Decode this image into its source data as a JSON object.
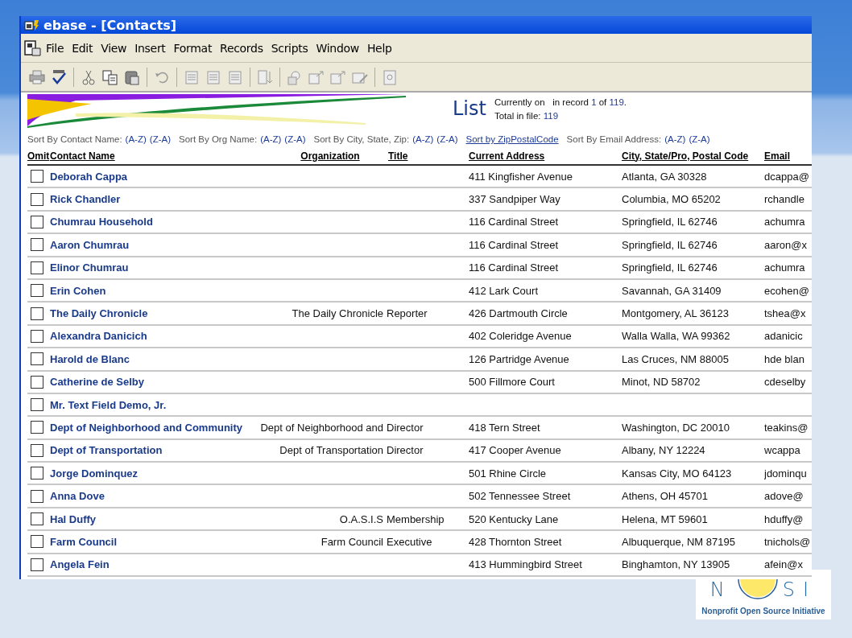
{
  "window": {
    "title": "ebase - [Contacts]"
  },
  "menu": [
    "File",
    "Edit",
    "View",
    "Insert",
    "Format",
    "Records",
    "Scripts",
    "Window",
    "Help"
  ],
  "header": {
    "title": "List",
    "record_line": [
      {
        "text": "Currently on   in record ",
        "highlight": false
      },
      {
        "text": "1",
        "highlight": true
      },
      {
        "text": " of ",
        "highlight": false
      },
      {
        "text": "119",
        "highlight": true
      },
      {
        "text": ".",
        "highlight": false
      }
    ],
    "total_line": [
      {
        "text": "Total in file: ",
        "highlight": false
      },
      {
        "text": "119",
        "highlight": true
      }
    ]
  },
  "sort_options": [
    {
      "kind": "pair",
      "label": "Sort By Contact Name:",
      "links": [
        "(A-Z)",
        "(Z-A)"
      ]
    },
    {
      "kind": "pair",
      "label": "Sort By Org Name:",
      "links": [
        "(A-Z)",
        "(Z-A)"
      ]
    },
    {
      "kind": "pair",
      "label": "Sort By City, State, Zip:",
      "links": [
        "(A-Z)",
        "(Z-A)"
      ]
    },
    {
      "kind": "link",
      "label": "Sort by ZipPostalCode"
    },
    {
      "kind": "pair",
      "label": "Sort By Email Address:",
      "links": [
        "(A-Z)",
        "(Z-A)"
      ]
    }
  ],
  "table": {
    "columns": [
      "Omit",
      "Contact Name",
      "Organization",
      "Title",
      "Current Address",
      "City, State/Pro, Postal Code",
      "Email"
    ],
    "rows": [
      {
        "omit": false,
        "name": "Deborah Cappa",
        "address": "411 Kingfisher Avenue",
        "city": "Atlanta, GA 30328",
        "email": "dcappa@"
      },
      {
        "omit": false,
        "name": "Rick Chandler",
        "address": "337 Sandpiper Way",
        "city": "Columbia, MO 65202",
        "email": "rchandle"
      },
      {
        "omit": false,
        "name": "Chumrau Household",
        "address": "116 Cardinal Street",
        "city": "Springfield, IL 62746",
        "email": "achumra"
      },
      {
        "omit": false,
        "name": "Aaron Chumrau",
        "address": "116 Cardinal Street",
        "city": "Springfield, IL 62746",
        "email": "aaron@x"
      },
      {
        "omit": false,
        "name": "Elinor Chumrau",
        "address": "116 Cardinal Street",
        "city": "Springfield, IL 62746",
        "email": "achumra"
      },
      {
        "omit": false,
        "name": "Erin Cohen",
        "address": "412 Lark Court",
        "city": "Savannah, GA 31409",
        "email": "ecohen@"
      },
      {
        "omit": false,
        "name": "The Daily Chronicle",
        "organization": "The Daily Chronicle",
        "title": "Reporter",
        "address": "426 Dartmouth Circle",
        "city": "Montgomery, AL 36123",
        "email": "tshea@x"
      },
      {
        "omit": false,
        "name": "Alexandra Danicich",
        "address": "402 Coleridge Avenue",
        "city": "Walla Walla, WA 99362",
        "email": "adanicic"
      },
      {
        "omit": false,
        "name": "Harold de Blanc",
        "address": "126 Partridge Avenue",
        "city": "Las Cruces, NM 88005",
        "email": "hde blan"
      },
      {
        "omit": false,
        "name": "Catherine de Selby",
        "address": "500 Fillmore Court",
        "city": "Minot, ND 58702",
        "email": "cdeselby"
      },
      {
        "omit": false,
        "name": "Mr. Text Field Demo, Jr."
      },
      {
        "omit": false,
        "name": "Dept of Neighborhood and Community",
        "organization": "Dept of Neighborhood and",
        "title": "Director",
        "address": "418 Tern Street",
        "city": "Washington, DC 20010",
        "email": "teakins@"
      },
      {
        "omit": false,
        "name": "Dept of Transportation",
        "organization": "Dept of Transportation",
        "title": "Director",
        "address": "417 Cooper Avenue",
        "city": "Albany, NY 12224",
        "email": "wcappa"
      },
      {
        "omit": false,
        "name": "Jorge Dominquez",
        "address": "501 Rhine Circle",
        "city": "Kansas City, MO 64123",
        "email": "jdominqu"
      },
      {
        "omit": false,
        "name": "Anna Dove",
        "address": "502 Tennessee Street",
        "city": "Athens, OH 45701",
        "email": "adove@"
      },
      {
        "omit": false,
        "name": "Hal Duffy",
        "organization": "O.A.S.I.S",
        "title": "Membership",
        "address": "520 Kentucky Lane",
        "city": "Helena, MT 59601",
        "email": "hduffy@"
      },
      {
        "omit": false,
        "name": "Farm Council",
        "organization": "Farm Council",
        "title": "Executive",
        "address": "428 Thornton Street",
        "city": "Albuquerque, NM 87195",
        "email": "tnichols@"
      },
      {
        "omit": false,
        "name": "Angela Fein",
        "address": "413 Hummingbird Street",
        "city": "Binghamton, NY 13905",
        "email": "afein@x"
      }
    ]
  },
  "logo": {
    "letters_left": "N",
    "letters_right": "SI",
    "tagline": "Nonprofit Open Source Initiative"
  }
}
